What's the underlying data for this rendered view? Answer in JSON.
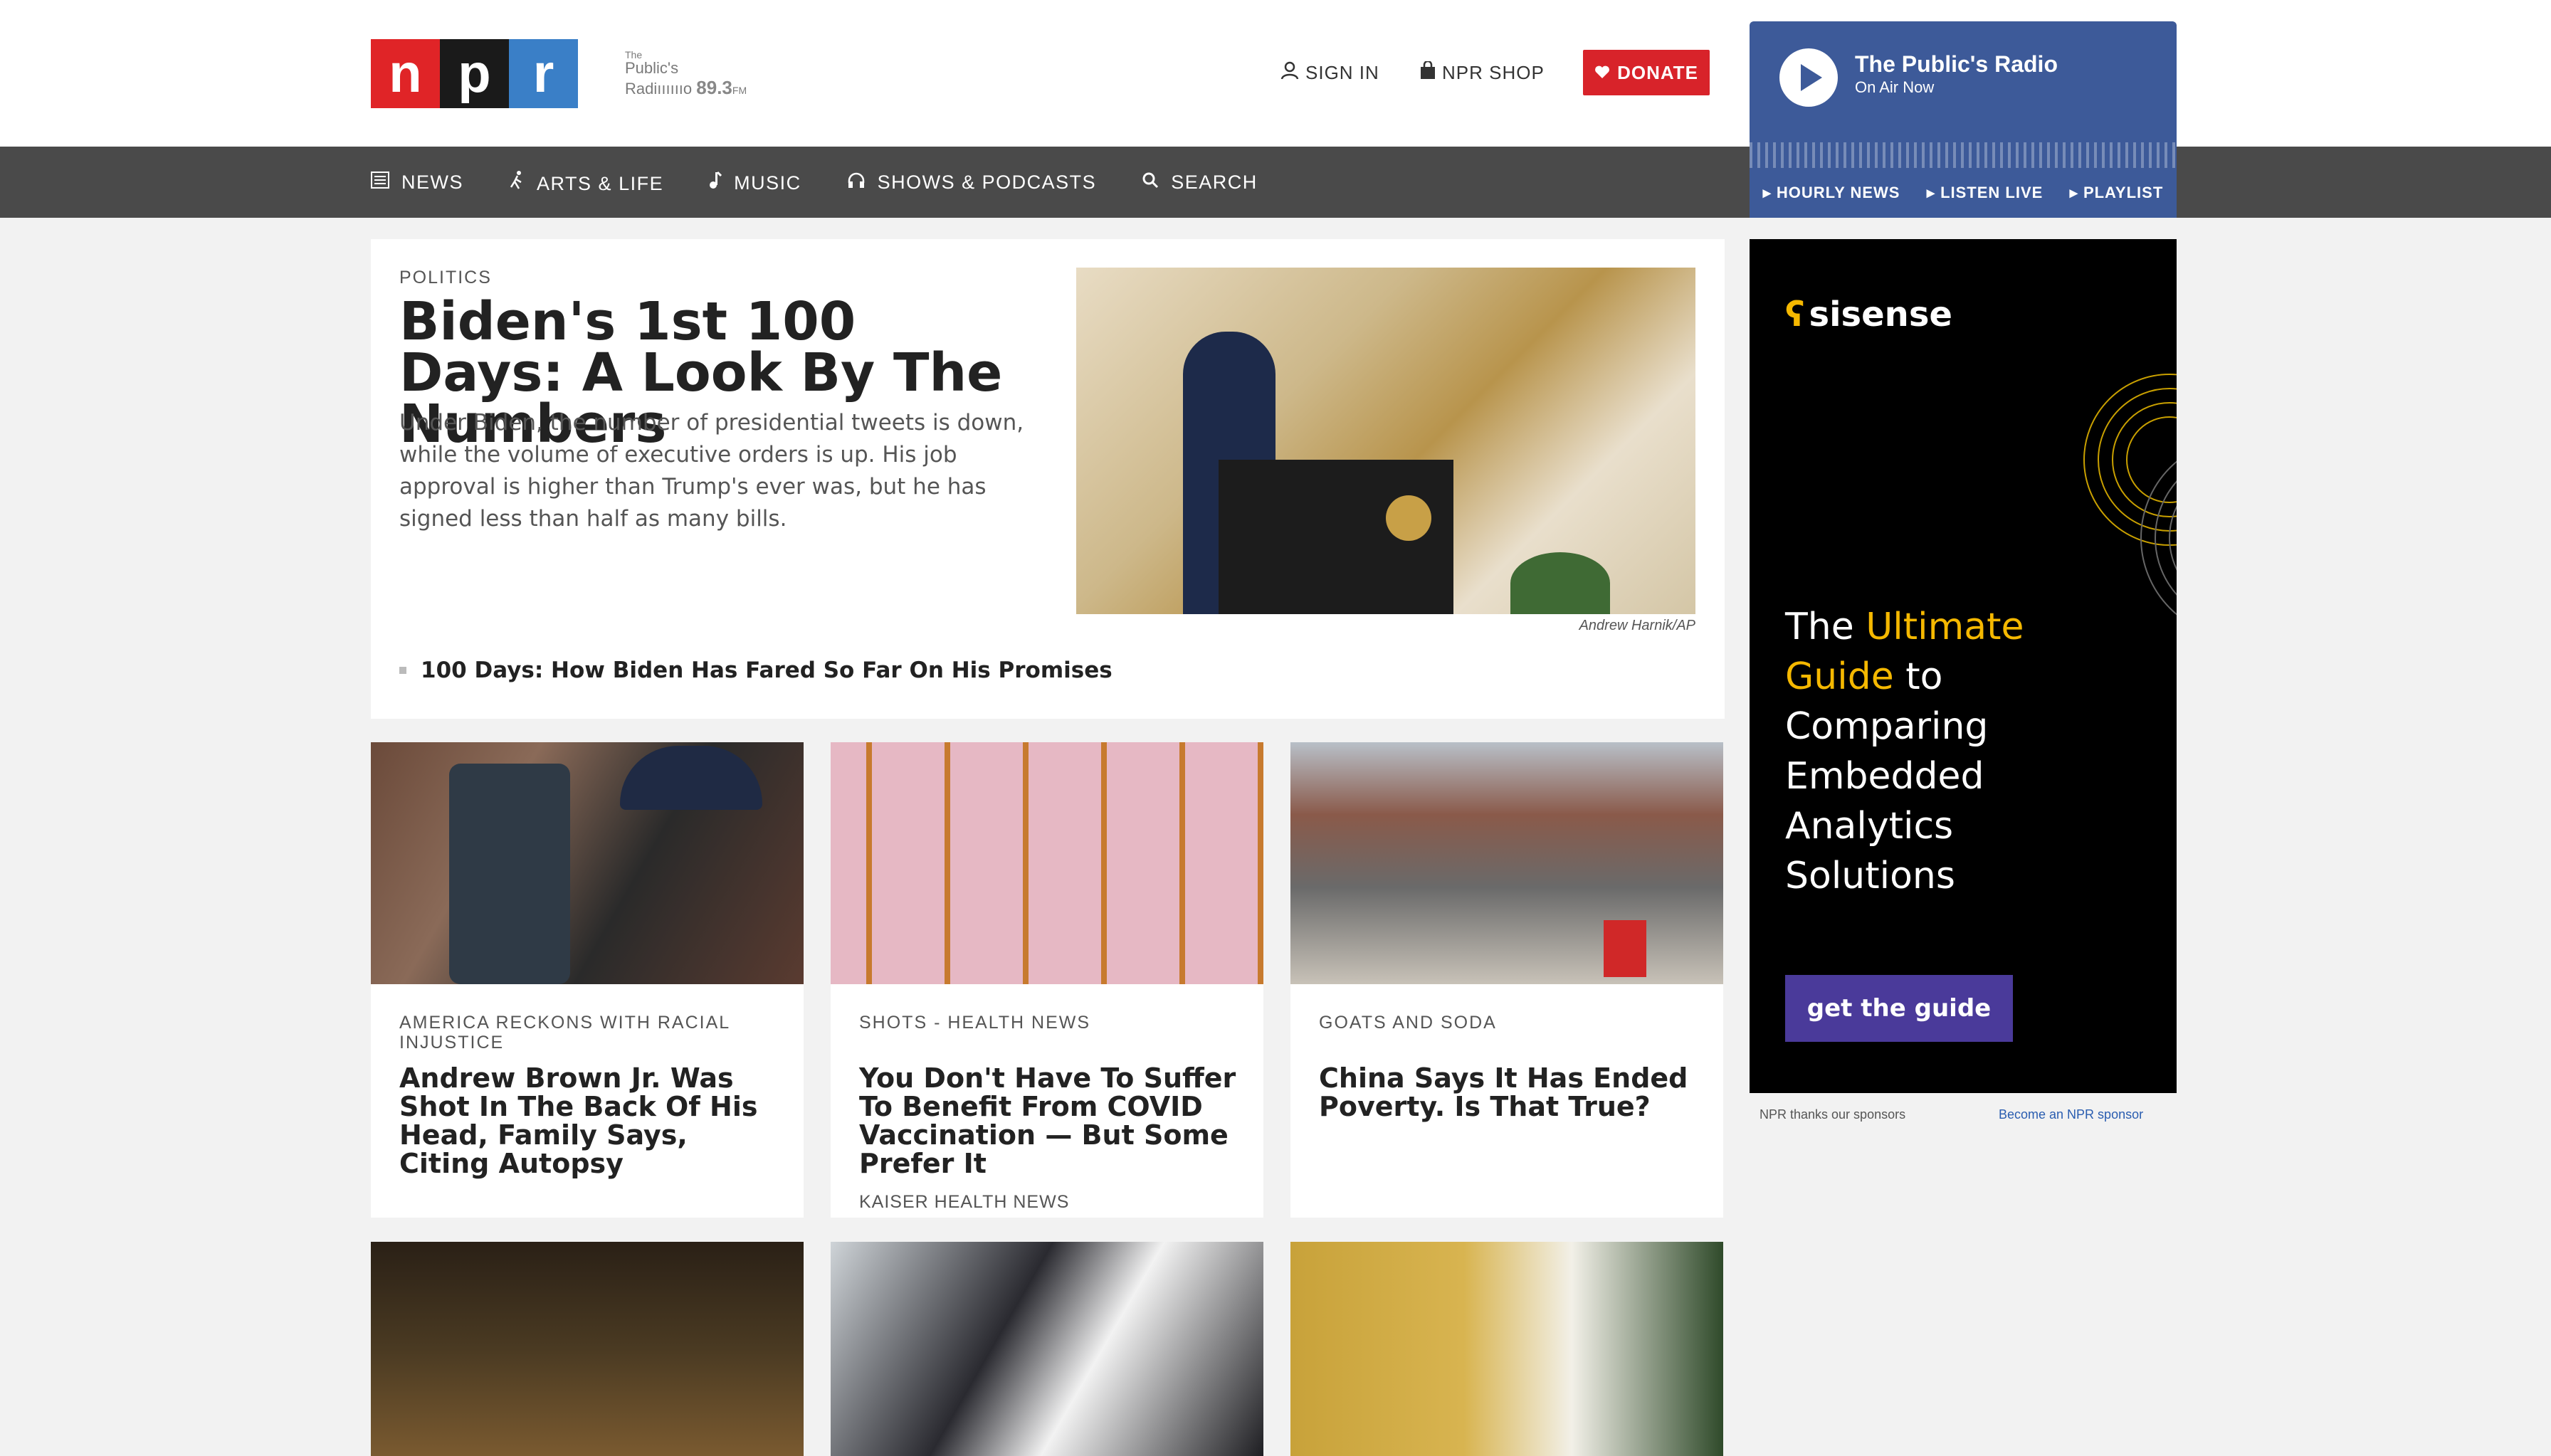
{
  "header": {
    "logo_letters": [
      "n",
      "p",
      "r"
    ],
    "station_line1": "The",
    "station_line2": "Public's",
    "station_line3": "Radiııııııo",
    "station_freq": "89.3",
    "station_band": "FM",
    "sign_in": "SIGN IN",
    "npr_shop": "NPR SHOP",
    "donate": "DONATE"
  },
  "player": {
    "station_name": "The Public's Radio",
    "status": "On Air Now",
    "links": [
      "HOURLY NEWS",
      "LISTEN LIVE",
      "PLAYLIST"
    ]
  },
  "nav": {
    "items": [
      {
        "label": "NEWS",
        "icon": "news-icon"
      },
      {
        "label": "ARTS & LIFE",
        "icon": "arts-icon"
      },
      {
        "label": "MUSIC",
        "icon": "music-note-icon"
      },
      {
        "label": "SHOWS & PODCASTS",
        "icon": "headphones-icon"
      },
      {
        "label": "SEARCH",
        "icon": "search-icon"
      }
    ]
  },
  "featured": {
    "slug": "POLITICS",
    "title": "Biden's 1st 100 Days: A Look By The Numbers",
    "teaser": "Under Biden, the number of presidential tweets is down, while the volume of executive orders is up. His job approval is higher than Trump's ever was, but he has signed less than half as many bills.",
    "credit": "Andrew Harnik/AP",
    "related": "100 Days: How Biden Has Fared So Far On His Promises"
  },
  "stories": [
    {
      "slug": "AMERICA RECKONS WITH RACIAL INJUSTICE",
      "title": "Andrew Brown Jr. Was Shot In The Back Of His Head, Family Says, Citing Autopsy",
      "source": ""
    },
    {
      "slug": "SHOTS - HEALTH NEWS",
      "title": "You Don't Have To Suffer To Benefit From COVID Vaccination — But Some Prefer It",
      "source": "KAISER HEALTH NEWS"
    },
    {
      "slug": "GOATS AND SODA",
      "title": "China Says It Has Ended Poverty. Is That True?",
      "source": ""
    }
  ],
  "ad": {
    "brand": "sisense",
    "headline_pre": "The ",
    "headline_highlight": "Ultimate Guide",
    "headline_post": " to Comparing Embedded Analytics Solutions",
    "cta": "get the guide",
    "sponsor_note": "NPR thanks our sponsors",
    "sponsor_link": "Become an NPR sponsor"
  }
}
